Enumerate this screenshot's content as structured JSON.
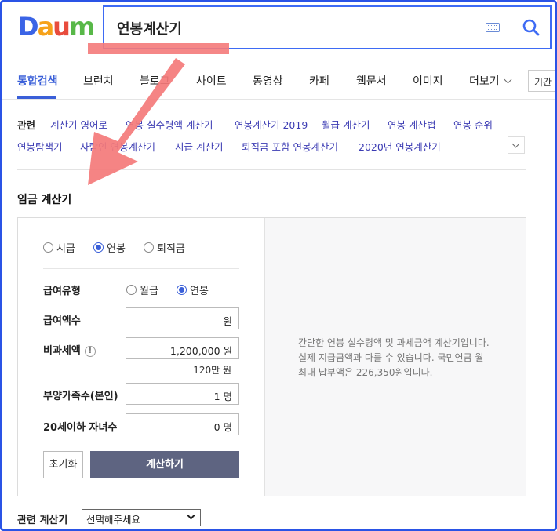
{
  "header": {
    "logo": "Daum",
    "search_value": "연봉계산기"
  },
  "tabs": [
    {
      "label": "통합검색"
    },
    {
      "label": "브런치"
    },
    {
      "label": "블로그"
    },
    {
      "label": "사이트"
    },
    {
      "label": "동영상"
    },
    {
      "label": "카페"
    },
    {
      "label": "웹문서"
    },
    {
      "label": "이미지"
    },
    {
      "label": "더보기"
    },
    {
      "label": "기간"
    }
  ],
  "related": {
    "label": "관련",
    "items": [
      "계산기 영어로",
      "연봉 실수령액 계산기",
      "연봉계산기 2019",
      "월급 계산기",
      "연봉 계산법",
      "연봉 순위",
      "연봉탐색기",
      "사람인 연봉계산기",
      "시급 계산기",
      "퇴직금 포함 연봉계산기",
      "2020년 연봉계산기"
    ]
  },
  "section_title": "임금 계산기",
  "calculator": {
    "mode_options": [
      "시급",
      "연봉",
      "퇴직금"
    ],
    "mode_selected": "연봉",
    "pay_type_label": "급여유형",
    "pay_type_options": [
      "월급",
      "연봉"
    ],
    "pay_type_selected": "연봉",
    "salary_label": "급여액수",
    "salary_value": "원",
    "nontax_label": "비과세액",
    "nontax_info": "!",
    "nontax_value": "1,200,000 원",
    "nontax_hint": "120만 원",
    "dependents_label": "부양가족수(본인)",
    "dependents_value": "1 명",
    "children_label": "20세이하 자녀수",
    "children_value": "0 명",
    "reset_label": "초기화",
    "calc_label": "계산하기",
    "info_text": "간단한 연봉 실수령액 및 과세금액 계산기입니다. 실제 지급금액과 다를 수 있습니다. 국민연금 월 최대 납부액은 226,350원입니다."
  },
  "related_calc": {
    "label": "관련 계산기",
    "selected": "선택해주세요"
  },
  "colors": {
    "accent": "#3a5fd8",
    "annotation": "#f47a7a",
    "frame": "#2a53e6"
  }
}
